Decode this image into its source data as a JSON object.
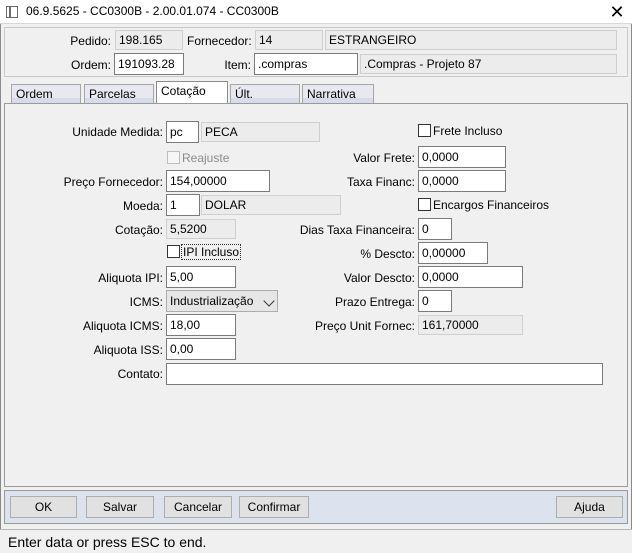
{
  "window": {
    "title": "06.9.5625 - CC0300B - 2.00.01.074 - CC0300B",
    "close_glyph": "✕"
  },
  "header": {
    "pedido_label": "Pedido:",
    "pedido_value": "198.165",
    "fornecedor_label": "Fornecedor:",
    "fornecedor_code": "14",
    "fornecedor_name": "ESTRANGEIRO",
    "ordem_label": "Ordem:",
    "ordem_value": "191093.28",
    "item_label": "Item:",
    "item_code": ".compras",
    "item_desc": ".Compras - Projeto 87"
  },
  "tabs": [
    {
      "label": "Ordem"
    },
    {
      "label": "Parcelas"
    },
    {
      "label": "Cotação"
    },
    {
      "label": "Últ. Compra"
    },
    {
      "label": "Narrativa"
    }
  ],
  "form": {
    "unidade_label": "Unidade Medida:",
    "unidade_code": "pc",
    "unidade_desc": "PECA",
    "reajuste_label": "Reajuste",
    "preco_label": "Preço Fornecedor:",
    "preco_value": "154,00000",
    "moeda_label": "Moeda:",
    "moeda_code": "1",
    "moeda_desc": "DOLAR",
    "cotacao_label": "Cotação:",
    "cotacao_value": "5,5200",
    "ipi_incluso_label": "IPI Incluso",
    "aliq_ipi_label": "Aliquota IPI:",
    "aliq_ipi_value": "5,00",
    "icms_label": "ICMS:",
    "icms_value": "Industrialização",
    "aliq_icms_label": "Aliquota ICMS:",
    "aliq_icms_value": "18,00",
    "aliq_iss_label": "Aliquota ISS:",
    "aliq_iss_value": "0,00",
    "contato_label": "Contato:",
    "contato_value": "",
    "frete_incluso_label": "Frete Incluso",
    "valor_frete_label": "Valor Frete:",
    "valor_frete_value": "0,0000",
    "taxa_financ_label": "Taxa Financ:",
    "taxa_financ_value": "0,0000",
    "encargos_label": "Encargos Financeiros",
    "dias_taxa_label": "Dias Taxa Financeira:",
    "dias_taxa_value": "0",
    "pct_descto_label": "% Descto:",
    "pct_descto_value": "0,00000",
    "valor_descto_label": "Valor Descto:",
    "valor_descto_value": "0,0000",
    "prazo_label": "Prazo Entrega:",
    "prazo_value": "0",
    "preco_unit_label": "Preço Unit Fornec:",
    "preco_unit_value": "161,70000"
  },
  "buttons": {
    "ok": "OK",
    "salvar": "Salvar",
    "cancelar": "Cancelar",
    "confirmar": "Confirmar",
    "ajuda": "Ajuda"
  },
  "status_text": "Enter data or press ESC to end.",
  "colors": {
    "button_bar": "#dce2ee",
    "panel": "#f0f0f0",
    "tab_inactive": "#e8e8f0"
  }
}
